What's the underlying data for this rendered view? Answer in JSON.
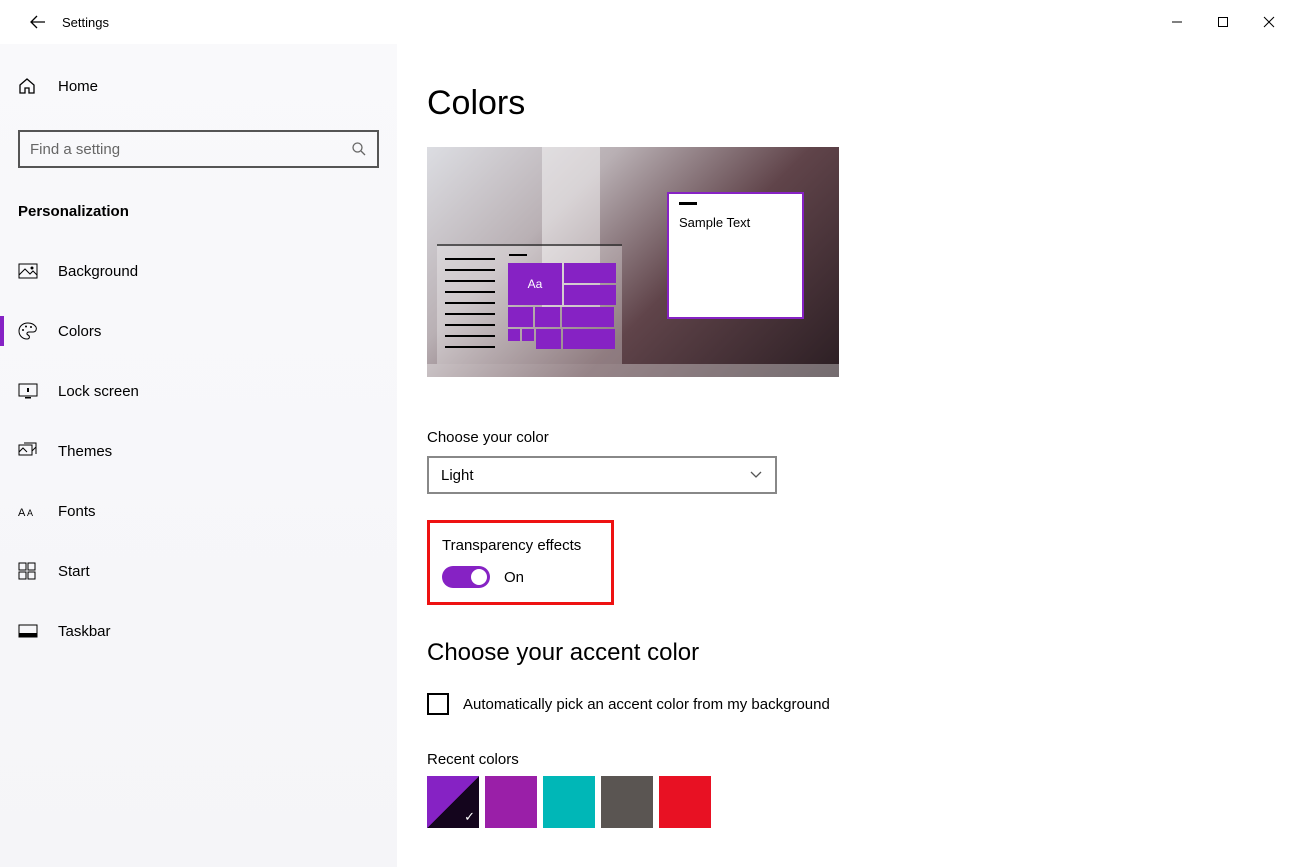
{
  "app_title": "Settings",
  "home_label": "Home",
  "search_placeholder": "Find a setting",
  "section": "Personalization",
  "nav_items": [
    {
      "label": "Background"
    },
    {
      "label": "Colors"
    },
    {
      "label": "Lock screen"
    },
    {
      "label": "Themes"
    },
    {
      "label": "Fonts"
    },
    {
      "label": "Start"
    },
    {
      "label": "Taskbar"
    }
  ],
  "active_nav_index": 1,
  "page_title": "Colors",
  "preview": {
    "sample_text": "Sample Text",
    "tile_text": "Aa"
  },
  "choose_color_label": "Choose your color",
  "choose_color_value": "Light",
  "transparency": {
    "label": "Transparency effects",
    "state_text": "On",
    "on": true
  },
  "accent_section_title": "Choose your accent color",
  "auto_accent_label": "Automatically pick an accent color from my background",
  "auto_accent_checked": false,
  "recent_colors_label": "Recent colors",
  "recent_colors": [
    {
      "hex": "#8622c4",
      "selected": true
    },
    {
      "hex": "#9a1fa8",
      "selected": false
    },
    {
      "hex": "#00b7b7",
      "selected": false
    },
    {
      "hex": "#5a5552",
      "selected": false
    },
    {
      "hex": "#e81123",
      "selected": false
    }
  ],
  "accent_hex": "#8622c4"
}
